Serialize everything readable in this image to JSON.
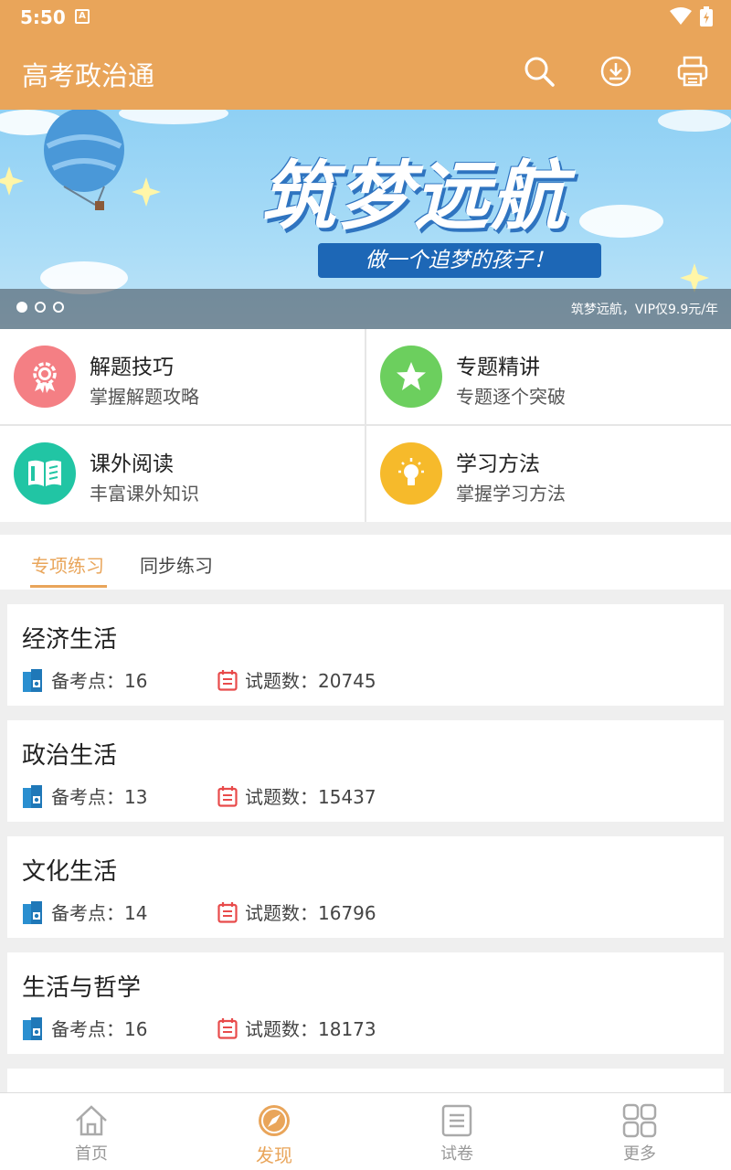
{
  "status": {
    "time": "5:50",
    "notif_letter": "A"
  },
  "app": {
    "title": "高考政治通"
  },
  "banner": {
    "headline": "筑梦远航",
    "subtitle": "做一个追梦的孩子！",
    "caption": "筑梦远航，VIP仅9.9元/年",
    "page_count": 3,
    "active_page": 1
  },
  "features": [
    {
      "title": "解题技巧",
      "subtitle": "掌握解题攻略",
      "icon": "medal-icon",
      "color": "#f47f84"
    },
    {
      "title": "专题精讲",
      "subtitle": "专题逐个突破",
      "icon": "star-icon",
      "color": "#6ccf5e"
    },
    {
      "title": "课外阅读",
      "subtitle": "丰富课外知识",
      "icon": "book-open-icon",
      "color": "#21c5a4"
    },
    {
      "title": "学习方法",
      "subtitle": "掌握学习方法",
      "icon": "lightbulb-icon",
      "color": "#f6ba2b"
    }
  ],
  "tabs": [
    {
      "label": "专项练习",
      "active": true
    },
    {
      "label": "同步练习",
      "active": false
    }
  ],
  "subjects": [
    {
      "name": "经济生活",
      "points_label": "备考点：16",
      "questions_label": "试题数：20745"
    },
    {
      "name": "政治生活",
      "points_label": "备考点：13",
      "questions_label": "试题数：15437"
    },
    {
      "name": "文化生活",
      "points_label": "备考点：14",
      "questions_label": "试题数：16796"
    },
    {
      "name": "生活与哲学",
      "points_label": "备考点：16",
      "questions_label": "试题数：18173"
    }
  ],
  "nav": [
    {
      "label": "首页",
      "icon": "home-icon",
      "active": false
    },
    {
      "label": "发现",
      "icon": "compass-icon",
      "active": true
    },
    {
      "label": "试卷",
      "icon": "paper-icon",
      "active": false
    },
    {
      "label": "更多",
      "icon": "grid-icon",
      "active": false
    }
  ],
  "colors": {
    "primary": "#e9a55a",
    "banner_pill": "#1d67b6",
    "accent_red": "#e84b4b",
    "book_blue": "#2a8fd0"
  }
}
